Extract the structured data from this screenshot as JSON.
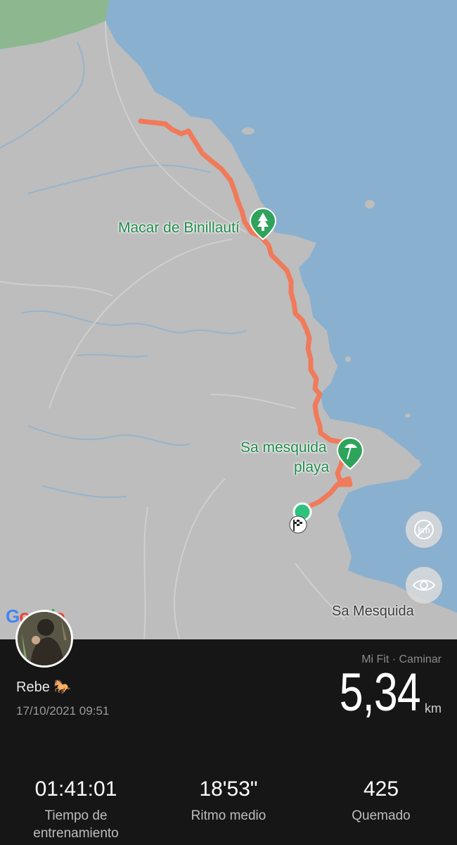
{
  "map": {
    "places": {
      "poi_macar": "Macar de Binillautí",
      "poi_sa_mesquida_line1": "Sa mesquida",
      "poi_sa_mesquida_line2": "playa",
      "town": "Sa Mesquida"
    },
    "logo": "Google",
    "route_color": "#f07a5a",
    "sea_color": "#8ab0d0",
    "land_color": "#bdbdbd",
    "buttons": [
      "distance-markers-toggle-icon",
      "visibility-eye-icon"
    ]
  },
  "workout": {
    "user_name": "Rebe 🐎",
    "datetime": "17/10/2021 09:51",
    "source": "Mi Fit · Caminar",
    "distance": "5,34",
    "distance_unit": "km",
    "stats": [
      {
        "value": "01:41:01",
        "label": "Tiempo de entrenamiento"
      },
      {
        "value": "18'53\"",
        "label": "Ritmo medio"
      },
      {
        "value": "425",
        "label": "Quemado"
      }
    ]
  }
}
